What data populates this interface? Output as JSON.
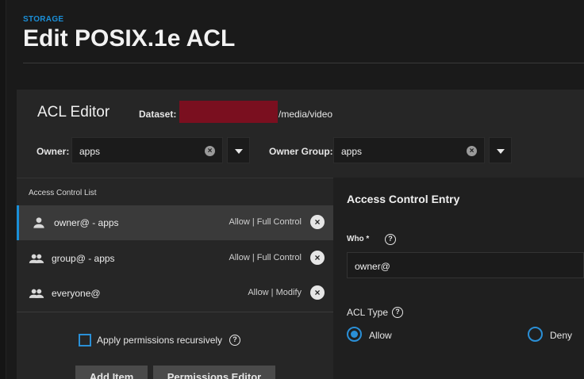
{
  "header": {
    "breadcrumb": "STORAGE",
    "title": "Edit POSIX.1e ACL"
  },
  "editor": {
    "title": "ACL Editor",
    "dataset_label": "Dataset:",
    "dataset_path_suffix": "/media/video",
    "owner_label": "Owner:",
    "owner_value": "apps",
    "owner_group_label": "Owner Group:",
    "owner_group_value": "apps"
  },
  "acl_list": {
    "title": "Access Control List",
    "items": [
      {
        "name": "owner@ - apps",
        "perm": "Allow | Full Control",
        "icon": "person-icon"
      },
      {
        "name": "group@ - apps",
        "perm": "Allow | Full Control",
        "icon": "group-icon"
      },
      {
        "name": "everyone@",
        "perm": "Allow | Modify",
        "icon": "group-icon"
      }
    ],
    "apply_recursive_label": "Apply permissions recursively",
    "add_item_label": "Add Item",
    "permissions_editor_label": "Permissions Editor"
  },
  "entry": {
    "title": "Access Control Entry",
    "who_label": "Who *",
    "who_value": "owner@",
    "acl_type_label": "ACL Type",
    "allow_label": "Allow",
    "deny_label": "Deny"
  },
  "colors": {
    "accent": "#1a8fd8",
    "redaction": "#7a0f1f"
  }
}
